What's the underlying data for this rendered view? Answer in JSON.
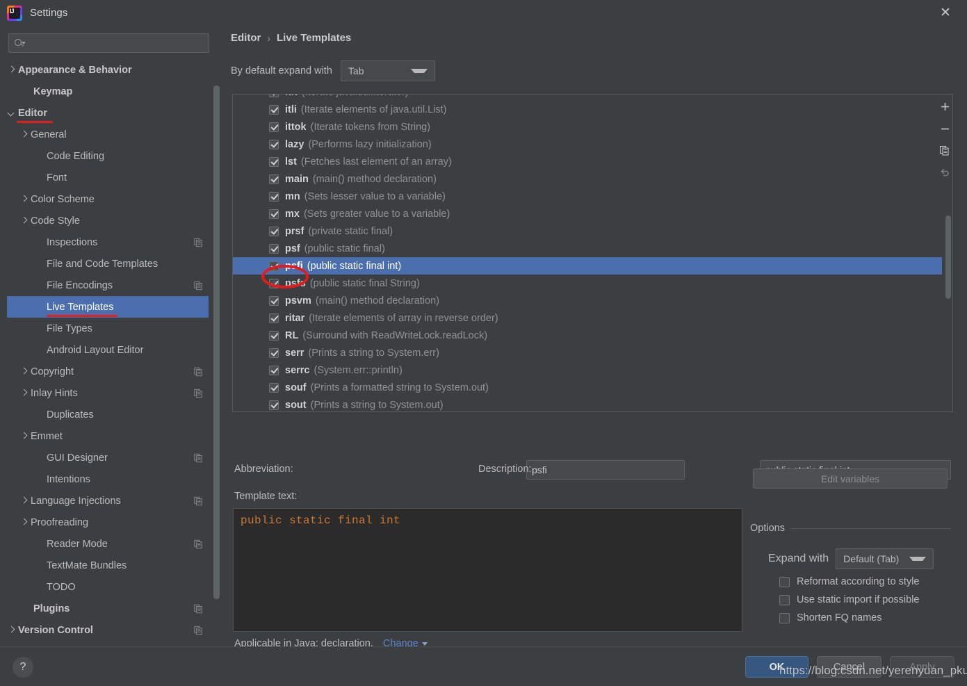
{
  "window": {
    "title": "Settings",
    "close_icon": "close-icon",
    "logo_text": "IJ"
  },
  "sidebar": {
    "search": {
      "placeholder": "",
      "value": "",
      "icon": "search-icon"
    },
    "items": [
      {
        "label": "Appearance & Behavior",
        "arrow": "right",
        "indent": 14,
        "bold": true,
        "badge": false
      },
      {
        "label": "Keymap",
        "arrow": "none",
        "indent": 38,
        "bold": true,
        "badge": false
      },
      {
        "label": "Editor",
        "arrow": "down",
        "indent": 14,
        "bold": true,
        "badge": false,
        "underline": true
      },
      {
        "label": "General",
        "arrow": "right",
        "indent": 34,
        "bold": false,
        "badge": false
      },
      {
        "label": "Code Editing",
        "arrow": "none",
        "indent": 57,
        "bold": false,
        "badge": false
      },
      {
        "label": "Font",
        "arrow": "none",
        "indent": 57,
        "bold": false,
        "badge": false
      },
      {
        "label": "Color Scheme",
        "arrow": "right",
        "indent": 34,
        "bold": false,
        "badge": false
      },
      {
        "label": "Code Style",
        "arrow": "right",
        "indent": 34,
        "bold": false,
        "badge": false
      },
      {
        "label": "Inspections",
        "arrow": "none",
        "indent": 57,
        "bold": false,
        "badge": true
      },
      {
        "label": "File and Code Templates",
        "arrow": "none",
        "indent": 57,
        "bold": false,
        "badge": false
      },
      {
        "label": "File Encodings",
        "arrow": "none",
        "indent": 57,
        "bold": false,
        "badge": true
      },
      {
        "label": "Live Templates",
        "arrow": "none",
        "indent": 57,
        "bold": false,
        "badge": false,
        "selected": true,
        "underline": true
      },
      {
        "label": "File Types",
        "arrow": "none",
        "indent": 57,
        "bold": false,
        "badge": false
      },
      {
        "label": "Android Layout Editor",
        "arrow": "none",
        "indent": 57,
        "bold": false,
        "badge": false
      },
      {
        "label": "Copyright",
        "arrow": "right",
        "indent": 34,
        "bold": false,
        "badge": true
      },
      {
        "label": "Inlay Hints",
        "arrow": "right",
        "indent": 34,
        "bold": false,
        "badge": true
      },
      {
        "label": "Duplicates",
        "arrow": "none",
        "indent": 57,
        "bold": false,
        "badge": false
      },
      {
        "label": "Emmet",
        "arrow": "right",
        "indent": 34,
        "bold": false,
        "badge": false
      },
      {
        "label": "GUI Designer",
        "arrow": "none",
        "indent": 57,
        "bold": false,
        "badge": true
      },
      {
        "label": "Intentions",
        "arrow": "none",
        "indent": 57,
        "bold": false,
        "badge": false
      },
      {
        "label": "Language Injections",
        "arrow": "right",
        "indent": 34,
        "bold": false,
        "badge": true
      },
      {
        "label": "Proofreading",
        "arrow": "right",
        "indent": 34,
        "bold": false,
        "badge": false
      },
      {
        "label": "Reader Mode",
        "arrow": "none",
        "indent": 57,
        "bold": false,
        "badge": true
      },
      {
        "label": "TextMate Bundles",
        "arrow": "none",
        "indent": 57,
        "bold": false,
        "badge": false
      },
      {
        "label": "TODO",
        "arrow": "none",
        "indent": 57,
        "bold": false,
        "badge": false
      },
      {
        "label": "Plugins",
        "arrow": "none",
        "indent": 38,
        "bold": true,
        "badge": true
      },
      {
        "label": "Version Control",
        "arrow": "right",
        "indent": 14,
        "bold": true,
        "badge": true
      }
    ]
  },
  "main": {
    "breadcrumb": {
      "parent": "Editor",
      "separator": "›",
      "current": "Live Templates"
    },
    "expand_default": {
      "label": "By default expand with",
      "value": "Tab"
    },
    "templates": [
      {
        "abbr": "itit",
        "desc": "(Iterate java.util.Iterator)",
        "checked": true
      },
      {
        "abbr": "itli",
        "desc": "(Iterate elements of java.util.List)",
        "checked": true
      },
      {
        "abbr": "ittok",
        "desc": "(Iterate tokens from String)",
        "checked": true
      },
      {
        "abbr": "lazy",
        "desc": "(Performs lazy initialization)",
        "checked": true
      },
      {
        "abbr": "lst",
        "desc": "(Fetches last element of an array)",
        "checked": true
      },
      {
        "abbr": "main",
        "desc": "(main() method declaration)",
        "checked": true
      },
      {
        "abbr": "mn",
        "desc": "(Sets lesser value to a variable)",
        "checked": true
      },
      {
        "abbr": "mx",
        "desc": "(Sets greater value to a variable)",
        "checked": true
      },
      {
        "abbr": "prsf",
        "desc": "(private static final)",
        "checked": true
      },
      {
        "abbr": "psf",
        "desc": "(public static final)",
        "checked": true
      },
      {
        "abbr": "psfi",
        "desc": "(public static final int)",
        "checked": true,
        "selected": true
      },
      {
        "abbr": "psfs",
        "desc": "(public static final String)",
        "checked": true
      },
      {
        "abbr": "psvm",
        "desc": "(main() method declaration)",
        "checked": true
      },
      {
        "abbr": "ritar",
        "desc": "(Iterate elements of array in reverse order)",
        "checked": true
      },
      {
        "abbr": "RL",
        "desc": "(Surround with ReadWriteLock.readLock)",
        "checked": true
      },
      {
        "abbr": "serr",
        "desc": "(Prints a string to System.err)",
        "checked": true
      },
      {
        "abbr": "serrc",
        "desc": "(System.err::println)",
        "checked": true
      },
      {
        "abbr": "souf",
        "desc": "(Prints a formatted string to System.out)",
        "checked": true
      },
      {
        "abbr": "sout",
        "desc": "(Prints a string to System.out)",
        "checked": true
      }
    ],
    "list_tools": [
      {
        "name": "add-template-button",
        "glyph": "+"
      },
      {
        "name": "remove-template-button",
        "glyph": "−"
      },
      {
        "name": "copy-template-button",
        "glyph": "copy"
      },
      {
        "name": "revert-template-button",
        "glyph": "revert"
      }
    ],
    "abbreviation": {
      "label": "Abbreviation:",
      "value": "psfi"
    },
    "description": {
      "label": "Description:",
      "value": "public static final int"
    },
    "template_text": {
      "label": "Template text:",
      "value": "public static final int"
    },
    "edit_variables_button": "Edit variables",
    "options": {
      "legend": "Options",
      "expand_with": {
        "label": "Expand with",
        "value": "Default (Tab)"
      },
      "checkboxes": [
        {
          "label": "Reformat according to style",
          "checked": false
        },
        {
          "label": "Use static import if possible",
          "checked": false
        },
        {
          "label": "Shorten FQ names",
          "checked": false
        }
      ]
    },
    "applicable": {
      "text": "Applicable in Java: declaration.",
      "change_link": "Change"
    }
  },
  "footer": {
    "help_glyph": "?",
    "ok_label": "OK",
    "cancel_label": "Cancel",
    "apply_label": "Apply"
  },
  "watermark": "https://blog.csdn.net/yerenyuan_pku",
  "colors": {
    "background": "#3c3f41",
    "selection": "#4b6eaf",
    "accent_link": "#5f86c9",
    "ok_button": "#365880",
    "code_text": "#cc7832",
    "annotation_red": "#e51b1b"
  }
}
